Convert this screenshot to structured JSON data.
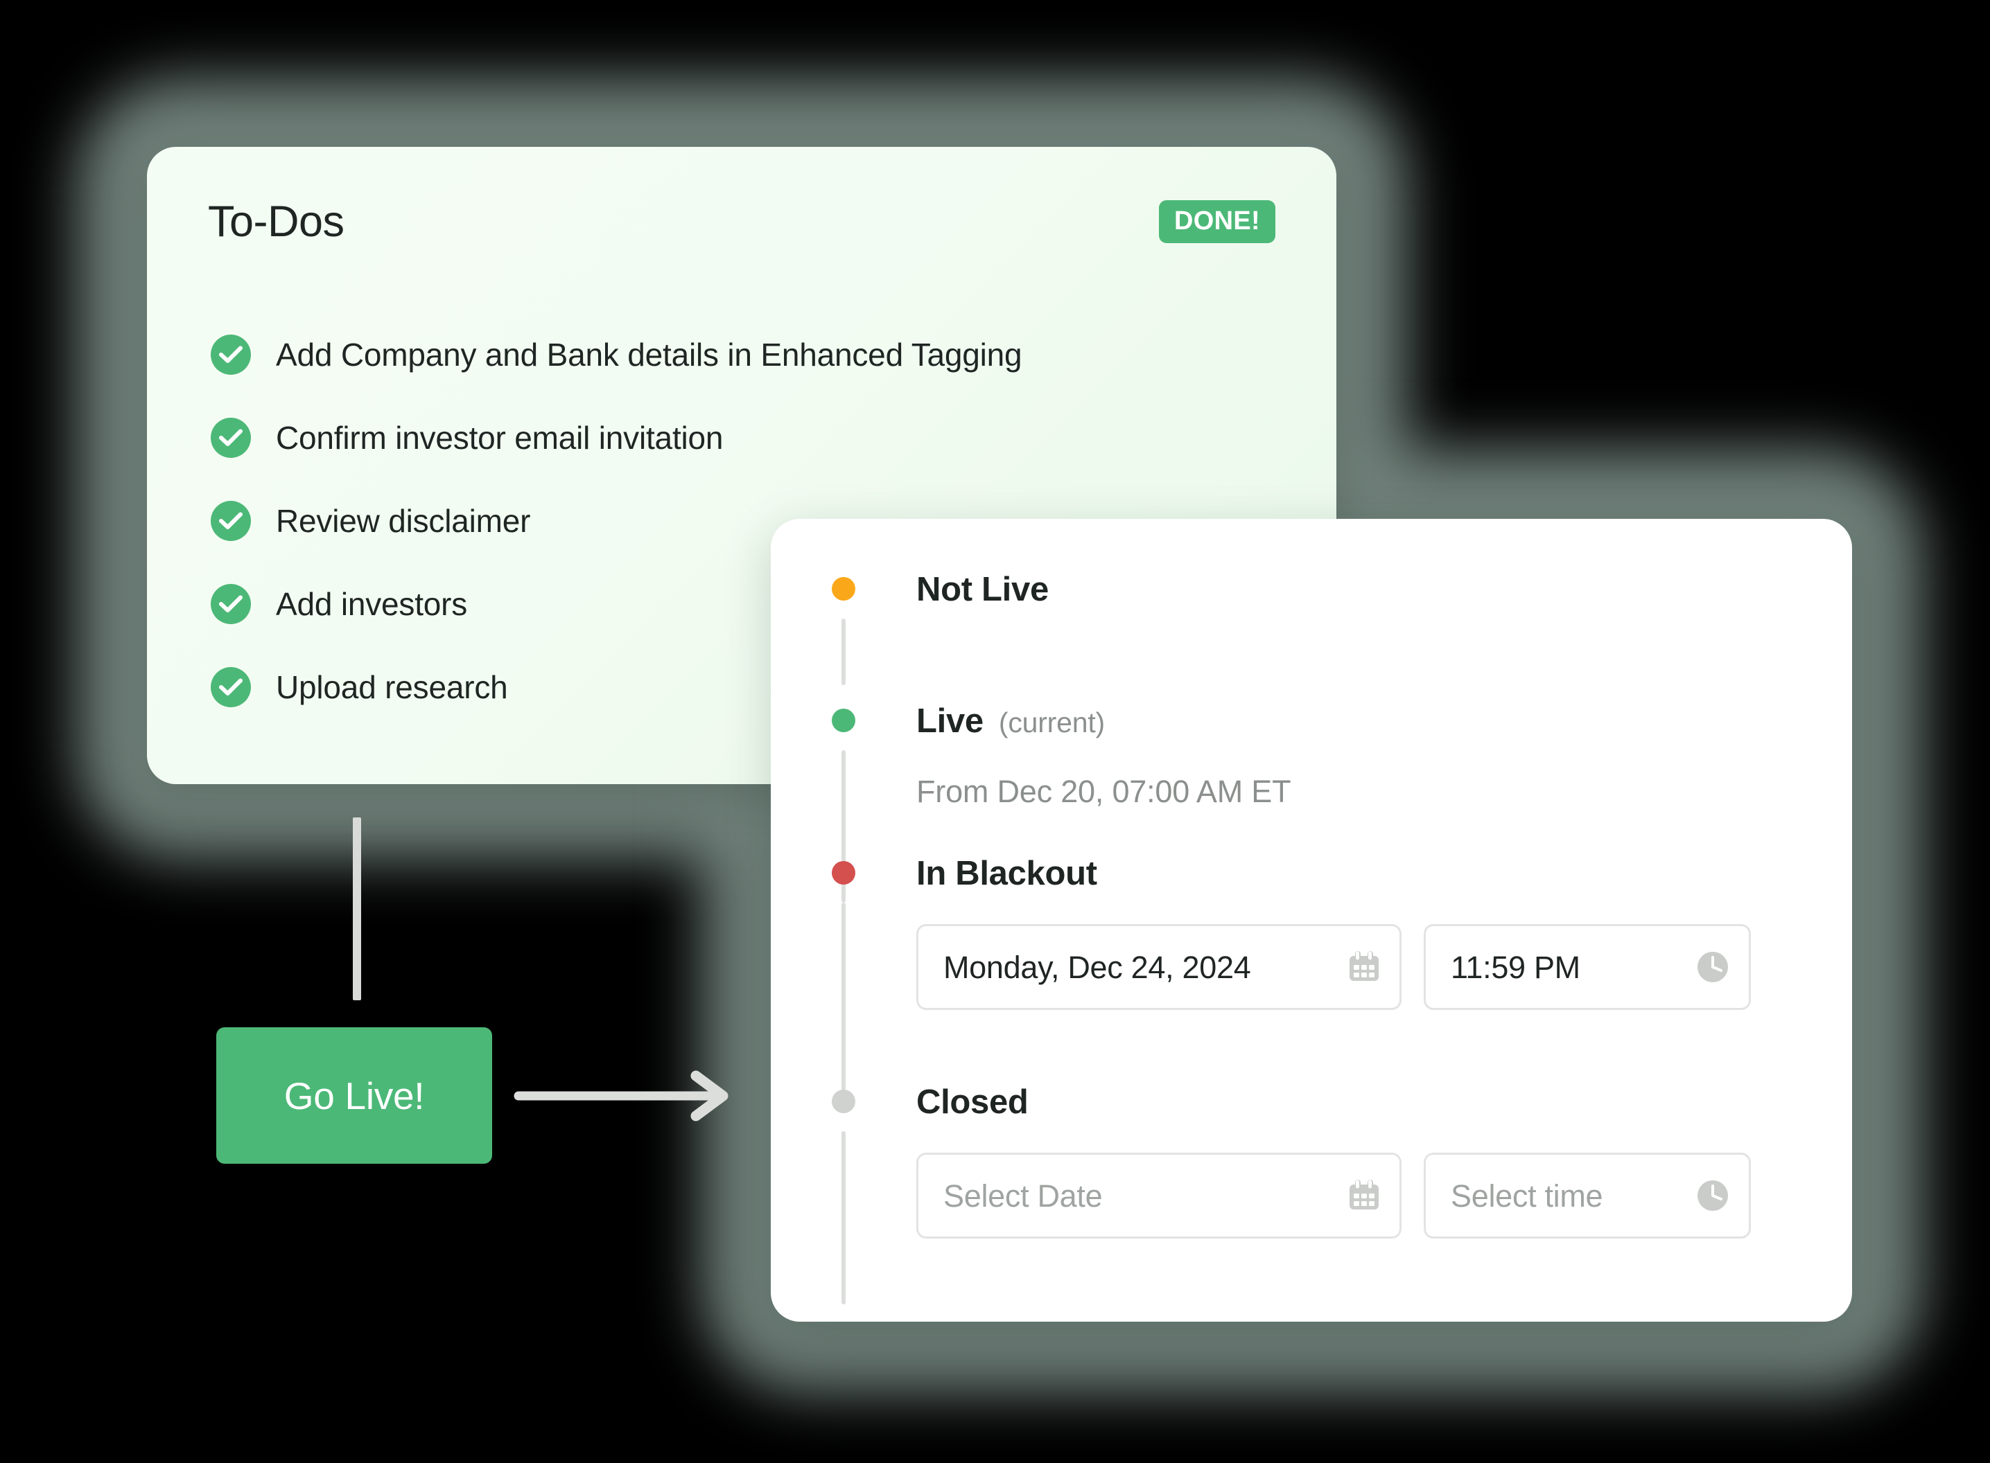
{
  "todo_card": {
    "title": "To-Dos",
    "badge": "DONE!",
    "items": [
      {
        "label": "Add Company and Bank details in Enhanced Tagging",
        "icon": "check-circle-icon"
      },
      {
        "label": "Confirm investor email invitation",
        "icon": "check-circle-icon"
      },
      {
        "label": "Review disclaimer",
        "icon": "check-circle-icon"
      },
      {
        "label": "Add investors",
        "icon": "check-circle-icon"
      },
      {
        "label": "Upload research",
        "icon": "check-circle-icon"
      }
    ]
  },
  "action": {
    "go_live_label": "Go Live!",
    "arrow_icon": "arrow-right-icon",
    "connector_icon": "vertical-connector-line"
  },
  "timeline_card": {
    "steps": [
      {
        "label": "Not Live",
        "note": "",
        "detail": "",
        "dot_color": "#FAA81A",
        "state": "upcoming"
      },
      {
        "label": "Live",
        "note": "(current)",
        "detail": "From Dec 20, 07:00 AM ET",
        "dot_color": "#4CB877",
        "state": "current"
      },
      {
        "label": "In Blackout",
        "note": "",
        "detail": "",
        "dot_color": "#D4504E",
        "state": "upcoming",
        "date_field": {
          "value": "Monday, Dec 24, 2024",
          "placeholder": "Select Date",
          "icon": "calendar-icon"
        },
        "time_field": {
          "value": "11:59 PM",
          "placeholder": "Select time",
          "icon": "clock-icon"
        }
      },
      {
        "label": "Closed",
        "note": "",
        "detail": "",
        "dot_color": "#D0D2D0",
        "state": "upcoming",
        "date_field": {
          "value": "",
          "placeholder": "Select Date",
          "icon": "calendar-icon"
        },
        "time_field": {
          "value": "",
          "placeholder": "Select time",
          "icon": "clock-icon"
        }
      }
    ]
  },
  "colors": {
    "brand_green": "#4CB877",
    "status_not_live": "#FAA81A",
    "status_live": "#4CB877",
    "status_blackout": "#D4504E",
    "status_closed": "#D0D2D0",
    "card_mint": "#F3FCF2",
    "glow": "#6F7F79",
    "text_primary": "#1F2523",
    "text_muted": "#8B908D"
  }
}
